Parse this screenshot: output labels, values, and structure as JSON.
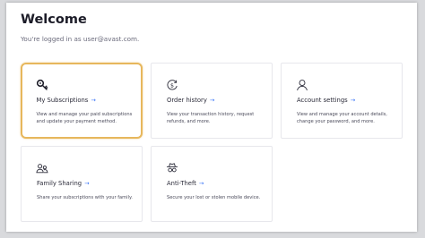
{
  "page": {
    "title": "Welcome",
    "subtitle": "You're logged in as user@avast.com."
  },
  "cards": [
    {
      "title": "My Subscriptions",
      "arrow": "→",
      "description": "View and manage your paid subscriptions and update your payment method.",
      "icon": "key-icon",
      "highlighted": true
    },
    {
      "title": "Order history",
      "arrow": "→",
      "description": "View your transaction history, request refunds, and more.",
      "icon": "dollar-circle-icon"
    },
    {
      "title": "Account settings",
      "arrow": "→",
      "description": "View and manage your account details, change your password, and more.",
      "icon": "user-icon"
    },
    {
      "title": "Family Sharing",
      "arrow": "→",
      "description": "Share your subscriptions with your family.",
      "icon": "family-icon"
    },
    {
      "title": "Anti-Theft",
      "arrow": "→",
      "description": "Secure your lost or stolen mobile device.",
      "icon": "spy-icon"
    }
  ],
  "colors": {
    "highlight_border": "#e7b75c",
    "link_arrow": "#2f6df6"
  }
}
